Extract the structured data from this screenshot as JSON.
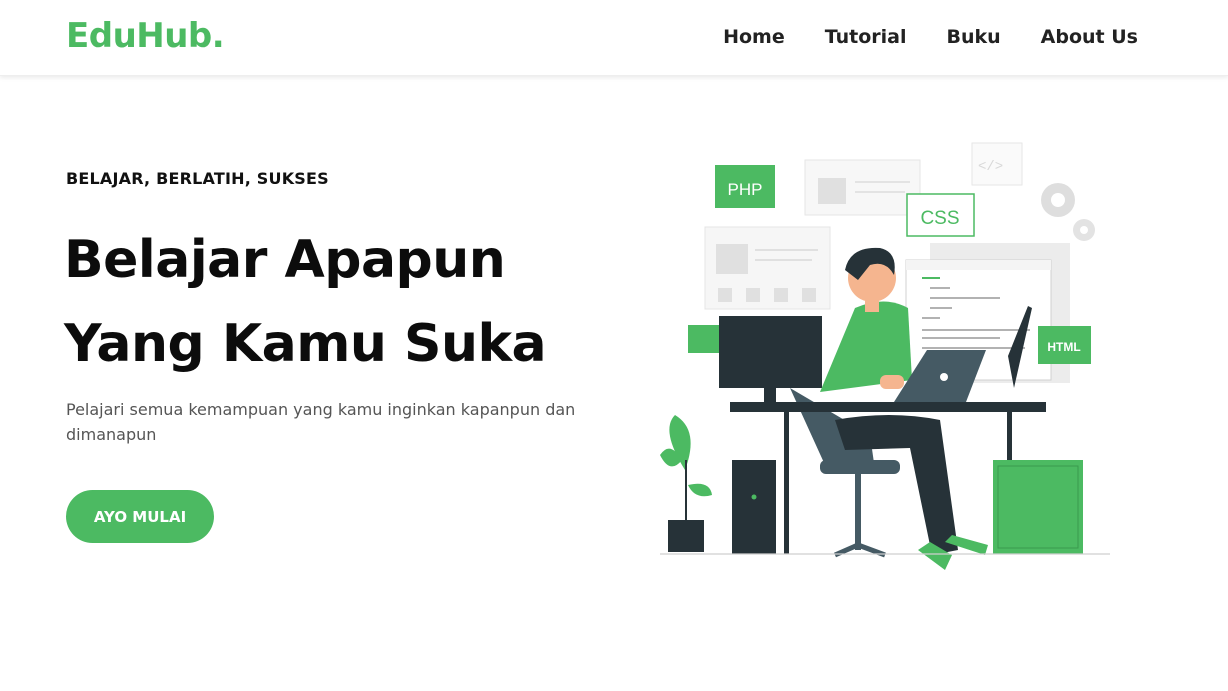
{
  "brand": {
    "name": "EduHub."
  },
  "nav": [
    {
      "label": "Home"
    },
    {
      "label": "Tutorial"
    },
    {
      "label": "Buku"
    },
    {
      "label": "About Us"
    }
  ],
  "hero": {
    "eyebrow": "BELAJAR, BERLATIH, SUKSES",
    "headline_line1": "Belajar Apapun",
    "headline_line2": "Yang Kamu Suka",
    "lead": "Pelajari semua kemampuan yang kamu inginkan kapanpun dan dimanapun",
    "cta_label": "AYO MULAI"
  },
  "illustration": {
    "php_label": "PHP",
    "css_label": "CSS",
    "html_label": "HTML"
  },
  "colors": {
    "accent": "#4cba62",
    "dark": "#263238",
    "text": "#111111"
  }
}
